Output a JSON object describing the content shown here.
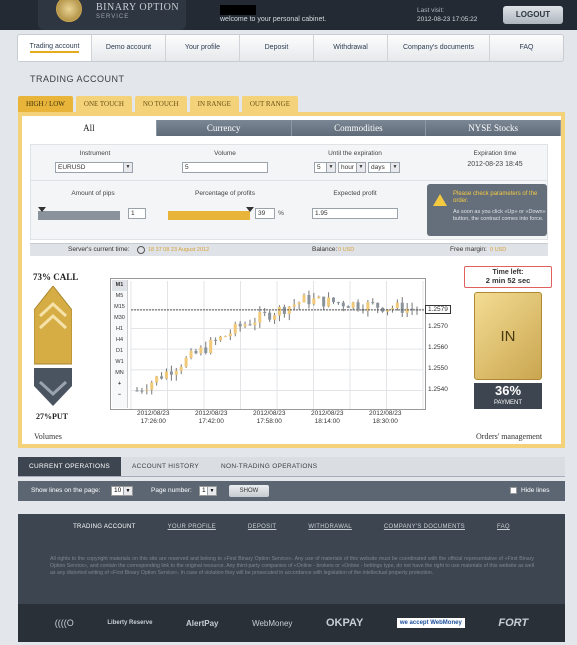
{
  "brand": {
    "name": "BINARY OPTION",
    "sub": "SERVICE"
  },
  "header": {
    "welcome": "welcome to your personal cabinet.",
    "last_visit_label": "Last visit:",
    "last_visit_date": "2012-08-23 17:05:22",
    "logout_label": "LOGOUT"
  },
  "nav": [
    {
      "label": "Trading account"
    },
    {
      "label": "Demo account"
    },
    {
      "label": "Your profile"
    },
    {
      "label": "Deposit"
    },
    {
      "label": "Withdrawal"
    },
    {
      "label": "Company's documents"
    },
    {
      "label": "FAQ"
    }
  ],
  "page_title": "TRADING ACCOUNT",
  "trade_types": [
    "HIGH / LOW",
    "ONE TOUCH",
    "NO TOUCH",
    "IN RANGE",
    "OUT RANGE"
  ],
  "markets": [
    "All",
    "Currency",
    "Commodities",
    "NYSE Stocks"
  ],
  "form": {
    "instrument_label": "Instrument",
    "instrument_value": "EURUSD",
    "volume_label": "Volume",
    "volume_value": "5",
    "expiration_label": "Until the expiration",
    "exp_num": "5",
    "exp_unit1": "hour",
    "exp_unit2": "days",
    "exp_time_label": "Expiration time",
    "exp_time_value": "2012-08-23 18:45",
    "pips_label": "Amount of pips",
    "pips_value": "1",
    "percent_label": "Percentage of profits",
    "percent_value": "39",
    "percent_unit": "%",
    "profit_label": "Expected profit",
    "profit_value": "1.95"
  },
  "info": {
    "title": "Please check parameters of the order.",
    "body": "As soon as you click «Up» or «Down» button, the contract comes into force."
  },
  "status": {
    "server_time_label": "Server's current time:",
    "server_time_value": "18 37 08 23 August 2012",
    "balance_label": "Balance:",
    "balance_value": "0 USD",
    "margin_label": "Free margin:",
    "margin_value": "0 USD"
  },
  "left": {
    "call": "73% CALL",
    "put": "27%PUT",
    "volumes": "Volumes"
  },
  "timeframes": [
    "M1",
    "M5",
    "M15",
    "M30",
    "H1",
    "H4",
    "D1",
    "W1",
    "MN"
  ],
  "chart_data": {
    "type": "candlestick",
    "categories": [
      "2012/08/23 17:26:00",
      "2012/08/23 17:42:00",
      "2012/08/23 17:58:00",
      "2012/08/23 18:14:00",
      "2012/08/23 18:30:00"
    ],
    "y_ticks": [
      "1.2579",
      "1.2570",
      "1.2560",
      "1.2550",
      "1.2540"
    ],
    "current_price": "1.2579",
    "ylim": [
      1.2533,
      1.2592
    ]
  },
  "right": {
    "time_left_label": "Time left:",
    "time_left_value": "2 min 52 sec",
    "in_label": "IN",
    "payment_pct": "36%",
    "payment_label": "PAYMENT",
    "orders": "Orders' management"
  },
  "ops_tabs": [
    "CURRENT OPERATIONS",
    "ACCOUNT HISTORY",
    "NON-TRADING OPERATIONS"
  ],
  "ops_bar": {
    "lines_label": "Show lines on the page:",
    "lines_value": "10",
    "page_label": "Page number:",
    "page_value": "1",
    "show_label": "SHOW",
    "hide_label": "Hide lines"
  },
  "footer": {
    "links": [
      "TRADING ACCOUNT",
      "YOUR PROFILE",
      "DEPOSIT",
      "WITHDRAWAL",
      "COMPANY'S DOCUMENTS",
      "FAQ"
    ],
    "copyright": "All rights to the copyright materials on this site are reserved and belong to «First Binary Option Service». Any use of materials of this website must be coordinated with the official representative of «First Binary Option Service», and contain the corresponding link to the original resource. Any third-party companies of «Online - brokers or «Online - bettings type, do not have the right to use materials of this website as well as any distorted writing of «First Binary Option Service». In case of violation they will be prosecuted in accordance with legislation of the intellectual property protection.",
    "payments": [
      "Liberty Reserve",
      "AlertPay",
      "WebMoney",
      "OKPAY",
      "we accept WebMoney",
      "FORT"
    ]
  },
  "colors": {
    "gold": "#e8b53a",
    "dark": "#3d4650",
    "accent_light": "#f3d27a"
  }
}
